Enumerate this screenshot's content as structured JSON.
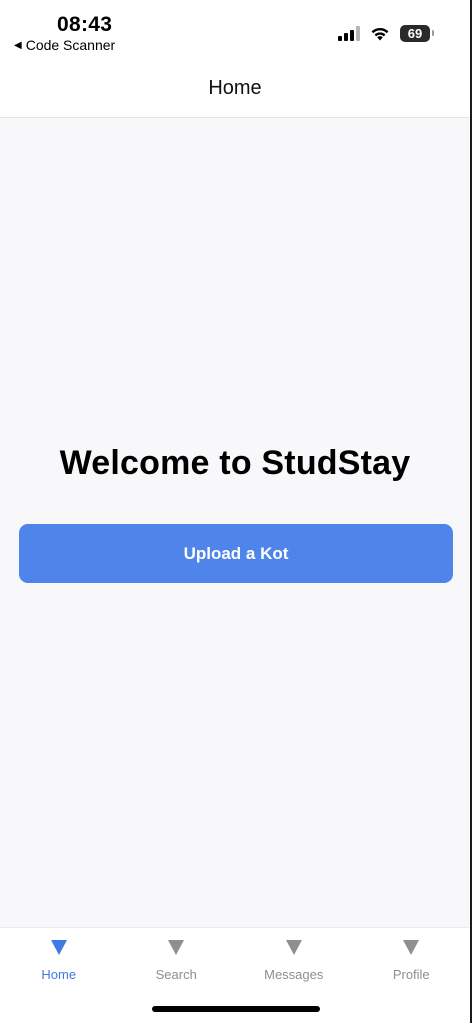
{
  "status_bar": {
    "time": "08:43",
    "back_app": "Code Scanner",
    "battery": "69"
  },
  "header": {
    "title": "Home"
  },
  "main": {
    "welcome": "Welcome to StudStay",
    "upload_button": "Upload a Kot"
  },
  "tabs": [
    {
      "label": "Home",
      "icon": "triangle-down-icon",
      "active": true
    },
    {
      "label": "Search",
      "icon": "triangle-down-icon",
      "active": false
    },
    {
      "label": "Messages",
      "icon": "triangle-down-icon",
      "active": false
    },
    {
      "label": "Profile",
      "icon": "triangle-down-icon",
      "active": false
    }
  ],
  "colors": {
    "accent": "#4f84ea",
    "active_tab": "#3f7be0",
    "inactive_tab": "#8e8e93"
  }
}
